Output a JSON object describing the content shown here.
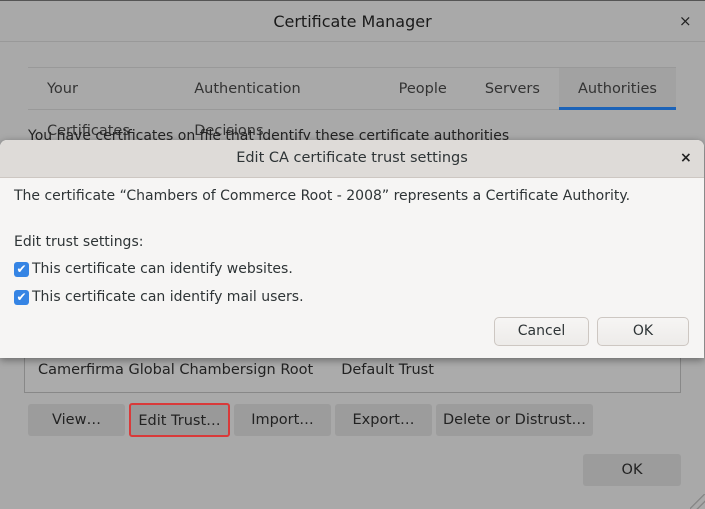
{
  "window": {
    "title": "Certificate Manager",
    "close": "×"
  },
  "tabs": [
    {
      "label": "Your Certificates"
    },
    {
      "label": "Authentication Decisions"
    },
    {
      "label": "People"
    },
    {
      "label": "Servers"
    },
    {
      "label": "Authorities",
      "active": true
    }
  ],
  "intro": "You have certificates on file that identify these certificate authorities",
  "list": {
    "row": {
      "name": "Camerfirma Global Chambersign Root",
      "trust": "Default Trust"
    }
  },
  "buttons": {
    "view": "View…",
    "edit_trust": "Edit Trust…",
    "import": "Import…",
    "export": "Export…",
    "delete": "Delete or Distrust…",
    "ok": "OK"
  },
  "dialog": {
    "title": "Edit CA certificate trust settings",
    "close": "×",
    "message": "The certificate “Chambers of Commerce Root - 2008” represents a Certificate Authority.",
    "settings_label": "Edit trust settings:",
    "checkboxes": [
      {
        "label": "This certificate can identify websites.",
        "checked": true
      },
      {
        "label": "This certificate can identify mail users.",
        "checked": true
      }
    ],
    "cancel": "Cancel",
    "ok": "OK"
  },
  "colors": {
    "accent": "#3584e4",
    "tab_underline": "#1c63b8",
    "highlight": "#d93a3a"
  }
}
